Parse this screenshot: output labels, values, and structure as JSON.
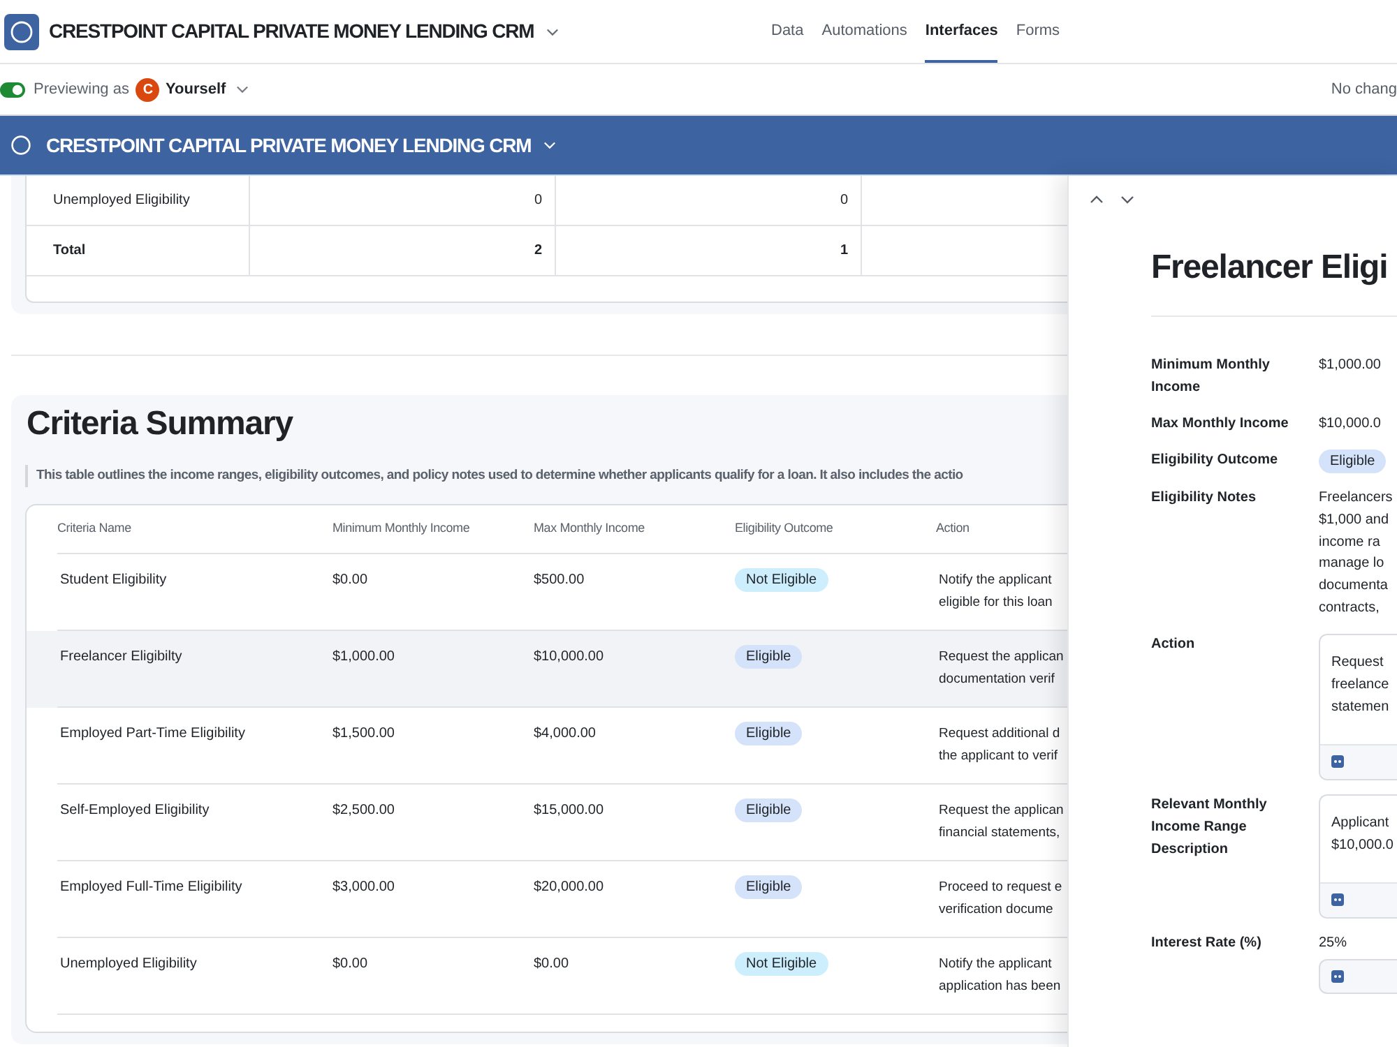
{
  "app": {
    "title": "CRESTPOINT CAPITAL PRIVATE MONEY LENDING CRM"
  },
  "nav_tabs": [
    {
      "label": "Data",
      "selected": false
    },
    {
      "label": "Automations",
      "selected": false
    },
    {
      "label": "Interfaces",
      "selected": true
    },
    {
      "label": "Forms",
      "selected": false
    }
  ],
  "preview_bar": {
    "toggle_on": true,
    "label": "Previewing as",
    "avatar_initial": "C",
    "user": "Yourself",
    "status": "No chang"
  },
  "interface_header": {
    "title": "CRESTPOINT CAPITAL PRIVATE MONEY LENDING CRM"
  },
  "summary_table": {
    "rows": [
      {
        "kind": "data",
        "cells": [
          "Unemployed Eligibility",
          "0",
          "0"
        ]
      },
      {
        "kind": "total",
        "cells": [
          "Total",
          "2",
          "1"
        ]
      }
    ]
  },
  "criteria_summary": {
    "title": "Criteria Summary",
    "description": "This table outlines the income ranges, eligibility outcomes, and policy notes used to determine whether applicants qualify for a loan. It also includes the actio",
    "table": {
      "columns": [
        "Criteria Name",
        "Minimum Monthly Income",
        "Max Monthly Income",
        "Eligibility Outcome",
        "Action"
      ],
      "rows": [
        {
          "selected": false,
          "criteria_name": "Student Eligibility",
          "minimum_monthly_income": "$0.00",
          "max_monthly_income": "$500.00",
          "outcome": {
            "label": "Not Eligible",
            "color": "#cdeefc"
          },
          "action": [
            "Notify the applicant",
            "eligible for this loan"
          ]
        },
        {
          "selected": true,
          "criteria_name": "Freelancer Eligibilty",
          "minimum_monthly_income": "$1,000.00",
          "max_monthly_income": "$10,000.00",
          "outcome": {
            "label": "Eligible",
            "color": "#d4e3fa"
          },
          "action": [
            "Request the applican",
            "documentation verif"
          ]
        },
        {
          "selected": false,
          "criteria_name": "Employed Part-Time Eligibility",
          "minimum_monthly_income": "$1,500.00",
          "max_monthly_income": "$4,000.00",
          "outcome": {
            "label": "Eligible",
            "color": "#d4e3fa"
          },
          "action": [
            "Request additional d",
            "the applicant to verif"
          ]
        },
        {
          "selected": false,
          "criteria_name": "Self-Employed Eligibility",
          "minimum_monthly_income": "$2,500.00",
          "max_monthly_income": "$15,000.00",
          "outcome": {
            "label": "Eligible",
            "color": "#d4e3fa"
          },
          "action": [
            "Request the applican",
            "financial statements,"
          ]
        },
        {
          "selected": false,
          "criteria_name": "Employed Full-Time Eligibility",
          "minimum_monthly_income": "$3,000.00",
          "max_monthly_income": "$20,000.00",
          "outcome": {
            "label": "Eligible",
            "color": "#d4e3fa"
          },
          "action": [
            "Proceed to request e",
            "verification docume"
          ]
        },
        {
          "selected": false,
          "criteria_name": "Unemployed Eligibility",
          "minimum_monthly_income": "$0.00",
          "max_monthly_income": "$0.00",
          "outcome": {
            "label": "Not Eligible",
            "color": "#cdeefc"
          },
          "action": [
            "Notify the applicant",
            "application has been"
          ]
        }
      ]
    }
  },
  "detail_panel": {
    "title": "Freelancer Eligi",
    "fields": [
      {
        "kind": "text",
        "label": "Minimum Monthly Income",
        "value": "$1,000.00"
      },
      {
        "kind": "text",
        "label": "Max Monthly Income",
        "value": "$10,000.0"
      },
      {
        "kind": "badge",
        "label": "Eligibility Outcome",
        "value": "Eligible",
        "color": "#d4e3fa"
      },
      {
        "kind": "lines",
        "label": "Eligibility Notes",
        "lines": [
          "Freelancers",
          "$1,000 and",
          "income ra",
          "manage lo",
          "documenta",
          "contracts,"
        ]
      },
      {
        "kind": "long_text",
        "label": "Action",
        "lines": [
          "Request",
          "freelance",
          "statemen"
        ]
      },
      {
        "kind": "long_text",
        "label": "Relevant Monthly Income Range Description",
        "lines": [
          "Applicant",
          "$10,000.0"
        ]
      },
      {
        "kind": "value_with_toolbar",
        "label": "Interest Rate (%)",
        "value": "25%"
      }
    ]
  }
}
